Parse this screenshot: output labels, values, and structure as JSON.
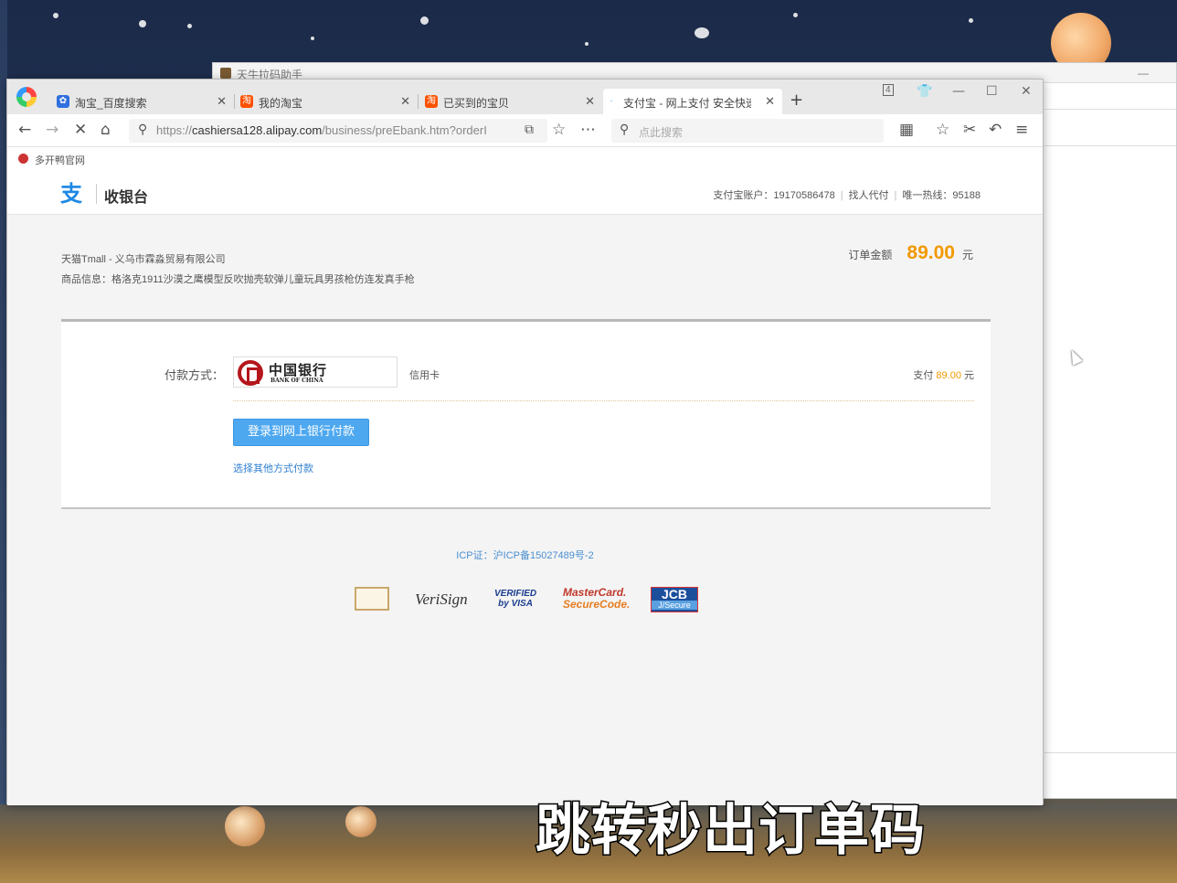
{
  "background_window": {
    "title": "天牛拉码助手"
  },
  "browser": {
    "tabs": [
      {
        "label": "淘宝_百度搜索"
      },
      {
        "label": "我的淘宝"
      },
      {
        "label": "已买到的宝贝"
      },
      {
        "label": "支付宝 - 网上支付 安全快速"
      }
    ],
    "tab_count": "4",
    "url_prefix": "https://",
    "url_host": "cashiersa128.alipay.com",
    "url_path": "/business/preEbank.htm?orderI",
    "search_placeholder": "点此搜索",
    "bookmark": "多开鸭官网"
  },
  "cashier": {
    "title": "收银台",
    "account_label": "支付宝账户：19170586478",
    "proxy_pay": "找人代付",
    "hotline": "唯一热线：95188",
    "merchant": "天猫Tmall - 义乌市霖淼贸易有限公司",
    "product": "商品信息：格洛克1911沙漠之鹰模型反吹抛壳软弹儿童玩具男孩枪仿连发真手枪",
    "amount_label": "订单金额",
    "amount": "89.00",
    "currency": "元",
    "payment_label": "付款方式：",
    "bank_name": "中国银行",
    "bank_name_en": "BANK OF CHINA",
    "card_type": "信用卡",
    "pay_prefix": "支付",
    "pay_amount": "89.00",
    "pay_suffix": "元",
    "login_button": "登录到网上银行付款",
    "other_method": "选择其他方式付款",
    "icp": "ICP证：沪ICP备15027489号-2",
    "badges": {
      "verisign": "VeriSign",
      "verified_1": "VERIFIED",
      "verified_2": "by VISA",
      "mastercard_1": "MasterCard.",
      "mastercard_2": "SecureCode.",
      "jcb_1": "JCB",
      "jcb_2": "J/Secure"
    }
  },
  "caption": "跳转秒出订单码",
  "colors": {
    "accent": "#f29900",
    "button": "#4ea8f0",
    "link": "#2f7fd1"
  }
}
